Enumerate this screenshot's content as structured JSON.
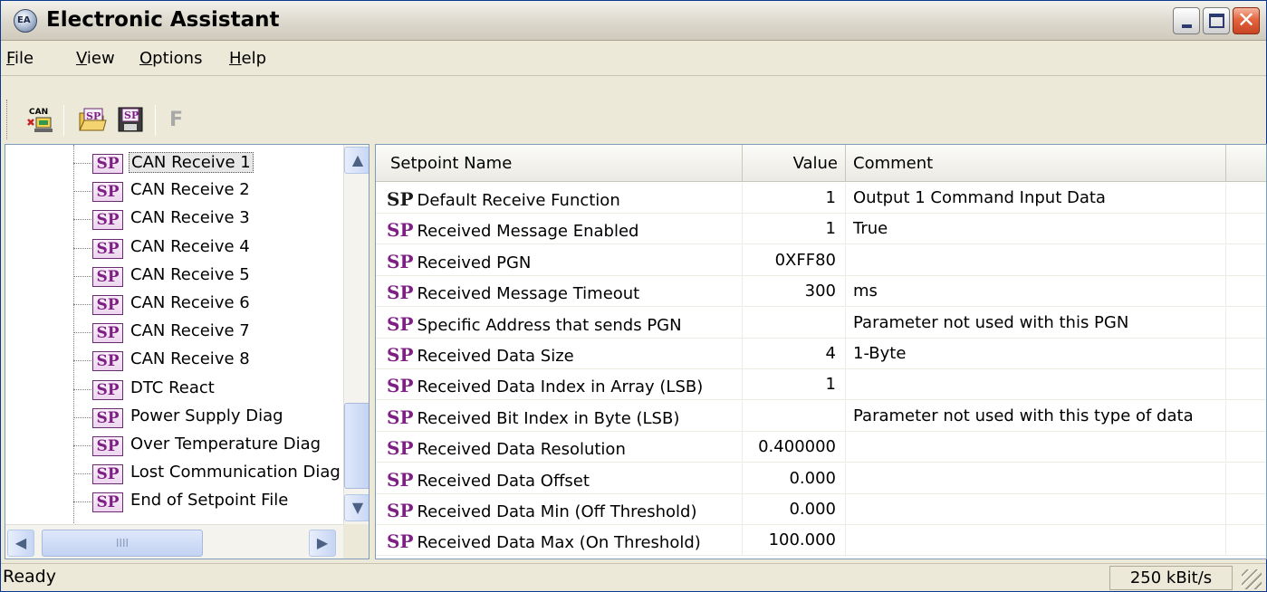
{
  "window": {
    "title": "Electronic Assistant",
    "icon_text": "EA",
    "controls": [
      "minimize-icon",
      "maximize-icon",
      "close-icon"
    ]
  },
  "menu": [
    {
      "label": "File",
      "mnemonic": "F",
      "rest": "ile"
    },
    {
      "label": "View",
      "mnemonic": "V",
      "rest": "iew"
    },
    {
      "label": "Options",
      "mnemonic": "O",
      "rest": "ptions"
    },
    {
      "label": "Help",
      "mnemonic": "H",
      "rest": "elp"
    }
  ],
  "toolbar": {
    "buttons": [
      {
        "icon": "can-connect-icon",
        "text": "CAN"
      },
      {
        "icon": "open-setpoint-icon",
        "text": "SP"
      },
      {
        "icon": "save-setpoint-icon",
        "text": "SP"
      }
    ],
    "disabled_button": "F"
  },
  "tree": {
    "items": [
      {
        "label": "CAN Receive 1",
        "selected": true
      },
      {
        "label": "CAN Receive 2"
      },
      {
        "label": "CAN Receive 3"
      },
      {
        "label": "CAN Receive 4"
      },
      {
        "label": "CAN Receive 5"
      },
      {
        "label": "CAN Receive 6"
      },
      {
        "label": "CAN Receive 7"
      },
      {
        "label": "CAN Receive 8"
      },
      {
        "label": "DTC React"
      },
      {
        "label": "Power Supply Diag"
      },
      {
        "label": "Over Temperature Diag"
      },
      {
        "label": "Lost Communication Diag"
      },
      {
        "label": "End of Setpoint File"
      }
    ],
    "icon_text": "SP",
    "hscroll_grip": "IIII"
  },
  "grid": {
    "columns": [
      "Setpoint Name",
      "Value",
      "Comment"
    ],
    "icon_text": "SP",
    "rows": [
      {
        "name": "Default Receive Function",
        "value": "1",
        "comment": "Output 1 Command Input Data",
        "dark": true
      },
      {
        "name": "Received Message Enabled",
        "value": "1",
        "comment": "True"
      },
      {
        "name": "Received PGN",
        "value": "0XFF80",
        "comment": ""
      },
      {
        "name": "Received Message Timeout",
        "value": "300",
        "comment": "ms"
      },
      {
        "name": "Specific Address that sends PGN",
        "value": "",
        "comment": "Parameter not used with this PGN"
      },
      {
        "name": "Received Data Size",
        "value": "4",
        "comment": "1-Byte"
      },
      {
        "name": "Received Data Index in Array (LSB)",
        "value": "1",
        "comment": ""
      },
      {
        "name": "Received Bit Index in Byte (LSB)",
        "value": "",
        "comment": "Parameter not used with this type of data"
      },
      {
        "name": "Received Data Resolution",
        "value": "0.400000",
        "comment": ""
      },
      {
        "name": "Received Data Offset",
        "value": "0.000",
        "comment": ""
      },
      {
        "name": "Received Data Min (Off Threshold)",
        "value": "0.000",
        "comment": ""
      },
      {
        "name": "Received Data Max (On Threshold)",
        "value": "100.000",
        "comment": ""
      }
    ]
  },
  "status": {
    "text": "Ready",
    "baud": "250 kBit/s"
  },
  "colors": {
    "sp_purple": "#7e1f84",
    "sp_dark": "#1a1a1a",
    "panel_border": "#7f9db9",
    "window_bg": "#ece9d8"
  }
}
